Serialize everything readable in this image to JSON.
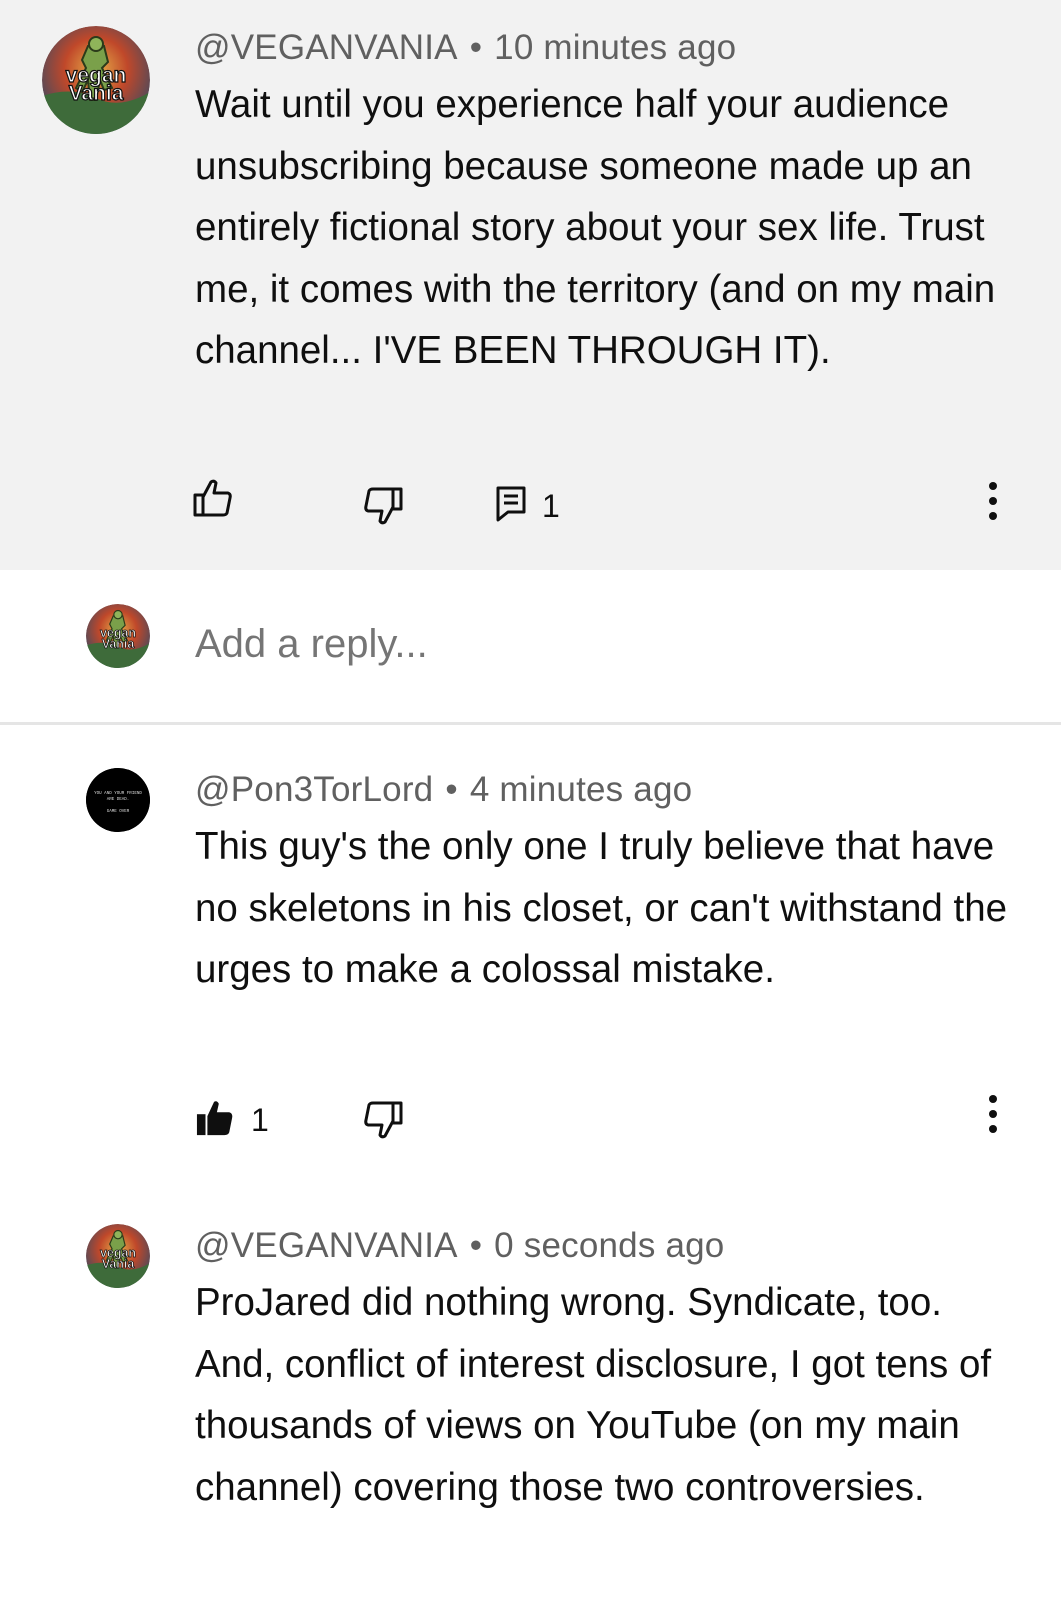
{
  "comment": {
    "author": "@VEGANVANIA",
    "time": "10 minutes ago",
    "text": "Wait until you experience half your audience unsubscribing because someone made up an entirely fictional story about your sex life.  Trust me, it comes with the territory (and on my main channel... I'VE BEEN THROUGH IT).",
    "reply_count": "1",
    "avatar_text": [
      "vegan",
      "Vania"
    ]
  },
  "reply_box": {
    "placeholder": "Add a reply..."
  },
  "replies": [
    {
      "author": "@Pon3TorLord",
      "time": "4 minutes ago",
      "text": "This guy's the only one I truly believe that have no skeletons in his closet, or can't withstand the urges to make a colossal mistake.",
      "like_count": "1",
      "liked": true,
      "avatar_text": [
        "YOU AND YOUR FRIEND",
        "ARE DEAD.",
        "GAME OVER"
      ]
    },
    {
      "author": "@VEGANVANIA",
      "time": "0 seconds ago",
      "text": "ProJared did nothing wrong.  Syndicate, too.  And, conflict of interest disclosure, I got tens of thousands of views on YouTube (on my main channel) covering those two controversies.",
      "avatar_text": [
        "vegan",
        "Vania"
      ]
    }
  ],
  "icons": {
    "like": "thumbs-up-icon",
    "dislike": "thumbs-down-icon",
    "reply": "comment-icon",
    "more": "more-vert-icon"
  },
  "colors": {
    "thread_background": "#f2f2f2",
    "meta_text": "#606060",
    "placeholder_text": "#909090"
  }
}
